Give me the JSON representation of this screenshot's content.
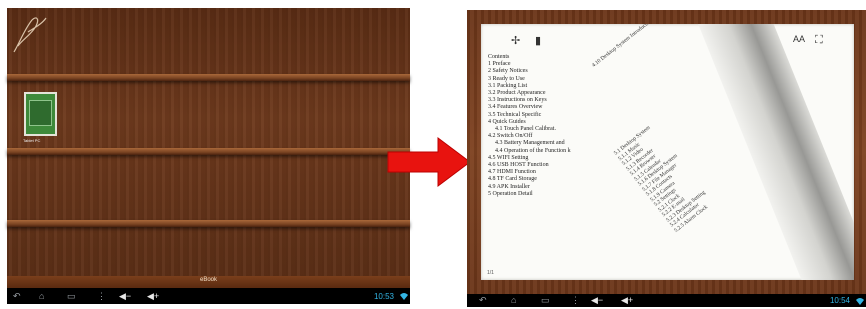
{
  "left": {
    "book": {
      "title": "Tablet PC"
    },
    "bottom_bar": {
      "label": "eBook"
    },
    "status": {
      "time": "10:53"
    }
  },
  "right": {
    "toolbar": {
      "font_size_label": "AA",
      "fullscreen_icon": "fullscreen-icon"
    },
    "toc_main": [
      "Contents",
      "1 Preface",
      "2 Safety Notices",
      "3 Ready to Use",
      "3.1 Packing List",
      "3.2 Product Appearance",
      "3.3 Instructions on Keys",
      "3.4 Features Overview",
      "3.5 Technical Specific",
      "4 Quick Guides",
      "4.1 Touch Panel Calibrat.",
      "4.2 Switch On/Off",
      "4.3 Battery Management and",
      "4.4 Operation of the Function k",
      "4.5 WIFI Setting",
      "4.6 USB HOST Function",
      "4.7 HDMI Function",
      "4.8 TF Card Storage",
      "4.9 APK Installer",
      "5 Operation Detail"
    ],
    "toc_rotated_a": [
      "4.10 Desktop System Introduction (Android)"
    ],
    "toc_rotated_b": [
      "5.1 Desktop System",
      "5.1.1 Music",
      "5.1.2 Video",
      "5.1.3 Recorder",
      "5.1.4 Browser",
      "5.1.5 Calendar",
      "5.1.6 Desktop System",
      "5.1.7 File Manager",
      "5.1.8 Contacts",
      "5.1.9 Camera",
      "5.2 Settings",
      "5.2.1 Clock",
      "5.2.2 E-mail",
      "5.2.3 Desktop Setting",
      "5.2.4 Calculator",
      "5.2.5 Alarm Clock"
    ],
    "page_number": "1/1",
    "status": {
      "time": "10:54"
    }
  },
  "colors": {
    "arrow": "#e8130f",
    "clock": "#33b5e5",
    "wood": "#6e3a1d"
  }
}
